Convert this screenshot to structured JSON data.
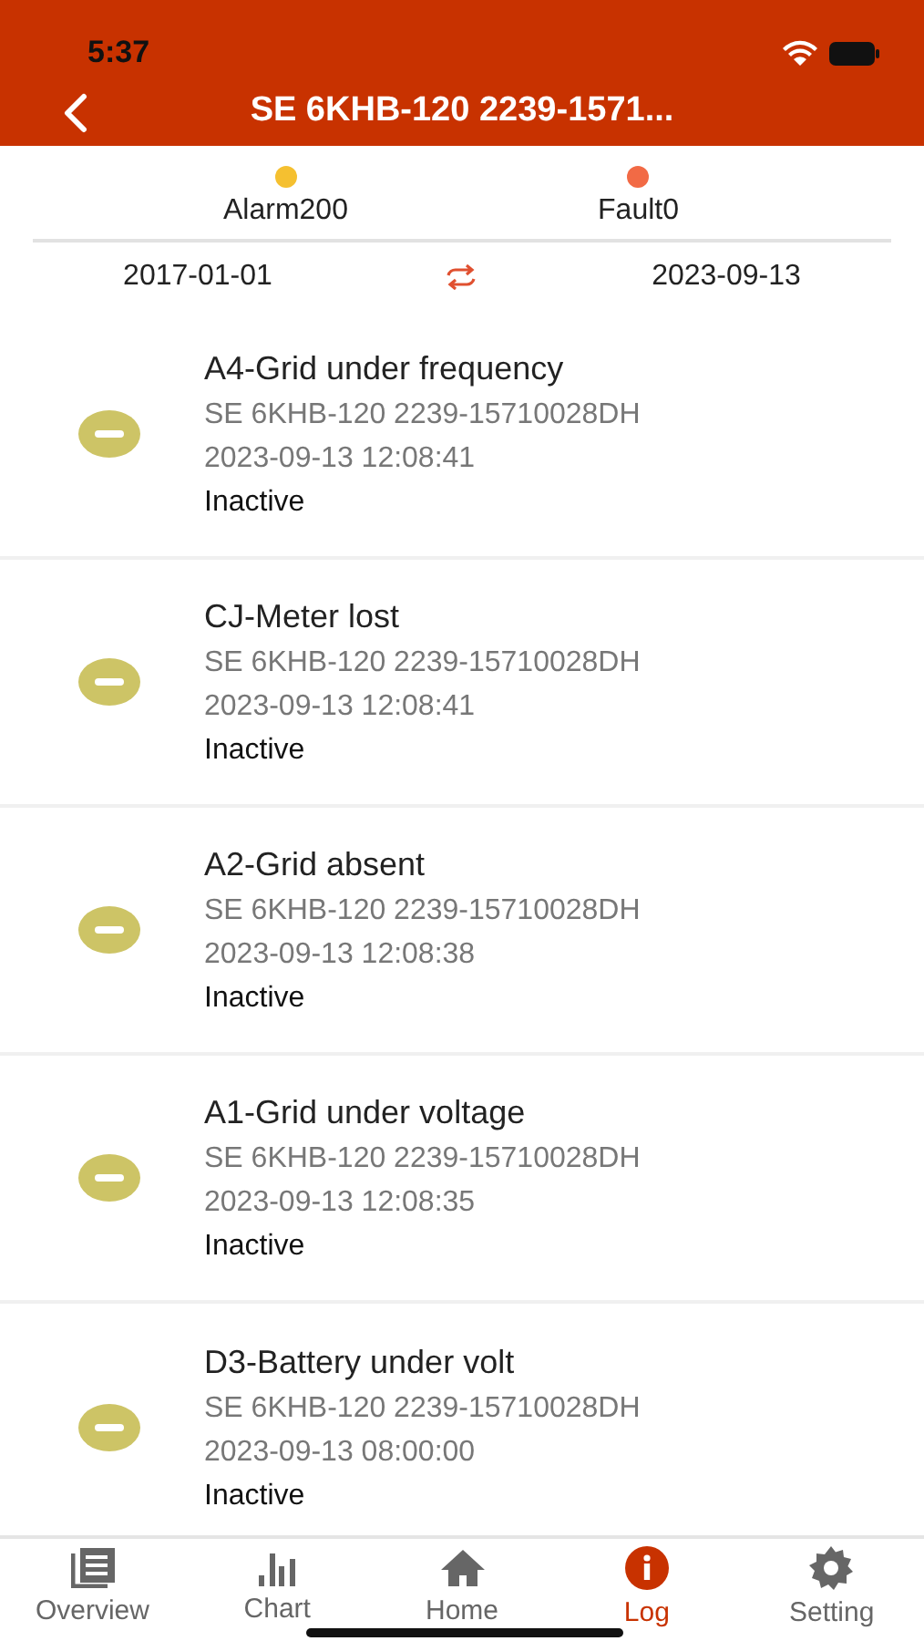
{
  "status_bar": {
    "time": "5:37"
  },
  "header": {
    "title": "SE 6KHB-120 2239-1571..."
  },
  "summary": [
    {
      "label": "Alarm200",
      "color": "#f5c030"
    },
    {
      "label": "Fault0",
      "color": "#f26a45"
    }
  ],
  "date_range": {
    "start": "2017-01-01",
    "end": "2023-09-13"
  },
  "events": [
    {
      "title": "A4-Grid under frequency",
      "device": "SE 6KHB-120 2239-15710028DH",
      "time": "2023-09-13 12:08:41",
      "status": "Inactive"
    },
    {
      "title": "CJ-Meter lost",
      "device": "SE 6KHB-120 2239-15710028DH",
      "time": "2023-09-13 12:08:41",
      "status": "Inactive"
    },
    {
      "title": "A2-Grid absent",
      "device": "SE 6KHB-120 2239-15710028DH",
      "time": "2023-09-13 12:08:38",
      "status": "Inactive"
    },
    {
      "title": "A1-Grid under voltage",
      "device": "SE 6KHB-120 2239-15710028DH",
      "time": "2023-09-13 12:08:35",
      "status": "Inactive"
    },
    {
      "title": "D3-Battery under volt",
      "device": "SE 6KHB-120 2239-15710028DH",
      "time": "2023-09-13 08:00:00",
      "status": "Inactive"
    }
  ],
  "tabs": [
    {
      "label": "Overview",
      "kind": "list",
      "selected": false
    },
    {
      "label": "Chart",
      "kind": "chart",
      "selected": false
    },
    {
      "label": "Home",
      "kind": "home",
      "selected": false
    },
    {
      "label": "Log",
      "kind": "info",
      "selected": true
    },
    {
      "label": "Setting",
      "kind": "gear",
      "selected": false
    }
  ]
}
